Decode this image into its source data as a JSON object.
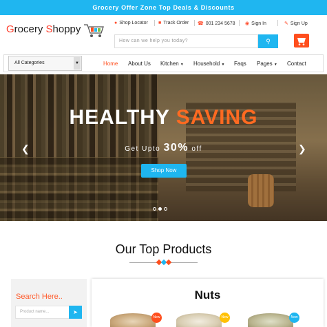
{
  "topbar": {
    "text": "Grocery Offer Zone Top Deals & Discounts"
  },
  "logo": {
    "g": "G",
    "rocery": "rocery ",
    "s": "S",
    "hoppy": "hoppy"
  },
  "header": {
    "links": [
      {
        "label": "Shop Locator",
        "icon": "map-marker-icon"
      },
      {
        "label": "Track Order",
        "icon": "truck-icon"
      },
      {
        "label": "001 234 5678",
        "icon": "phone-icon"
      },
      {
        "label": "Sign In",
        "icon": "user-icon"
      },
      {
        "label": "Sign Up",
        "icon": "edit-icon"
      }
    ],
    "search_placeholder": "How can we help you today?"
  },
  "nav": {
    "category_select": "All Categories",
    "items": [
      {
        "label": "Home"
      },
      {
        "label": "About Us"
      },
      {
        "label": "Kitchen"
      },
      {
        "label": "Household"
      },
      {
        "label": "Faqs"
      },
      {
        "label": "Pages"
      },
      {
        "label": "Contact"
      }
    ],
    "active_item": "Home"
  },
  "hero": {
    "title_main": "HEALTHY ",
    "title_accent": "SAVING",
    "sub_prefix": "Get Upto ",
    "sub_value": "30%",
    "sub_suffix": " off",
    "button": "Shop Now",
    "slides": 3,
    "active_slide": 1
  },
  "section": {
    "title": "Our Top Products"
  },
  "sidebar": {
    "title": "Search Here..",
    "placeholder": "Product name..."
  },
  "panel": {
    "title": "Nuts",
    "badges": [
      "New",
      "New",
      "New"
    ]
  },
  "colors": {
    "accent": "#1fb6f0",
    "orange": "#ff4e1d",
    "red": "#ff3d2b"
  }
}
